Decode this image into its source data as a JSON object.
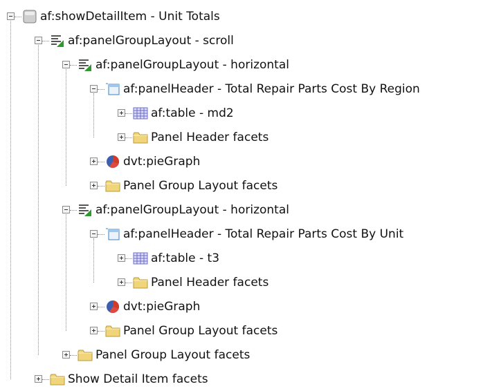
{
  "tree": {
    "nodes": [
      {
        "label": "af:showDetailItem - Unit Totals",
        "icon": "show-detail-item-icon",
        "expanded": true
      },
      {
        "label": "af:panelGroupLayout - scroll",
        "icon": "panel-group-layout-icon",
        "expanded": true
      },
      {
        "label": "af:panelGroupLayout - horizontal",
        "icon": "panel-group-layout-icon",
        "expanded": true
      },
      {
        "label": "af:panelHeader - Total Repair Parts Cost By Region",
        "icon": "panel-header-icon",
        "expanded": true
      },
      {
        "label": "af:table - md2",
        "icon": "table-icon",
        "expanded": false
      },
      {
        "label": "Panel Header facets",
        "icon": "folder-icon",
        "expanded": false
      },
      {
        "label": "dvt:pieGraph",
        "icon": "pie-graph-icon",
        "expanded": false
      },
      {
        "label": "Panel Group Layout facets",
        "icon": "folder-icon",
        "expanded": false
      },
      {
        "label": "af:panelGroupLayout - horizontal",
        "icon": "panel-group-layout-icon",
        "expanded": true
      },
      {
        "label": "af:panelHeader - Total Repair Parts Cost By Unit",
        "icon": "panel-header-icon",
        "expanded": true
      },
      {
        "label": "af:table - t3",
        "icon": "table-icon",
        "expanded": false
      },
      {
        "label": "Panel Header facets",
        "icon": "folder-icon",
        "expanded": false
      },
      {
        "label": "dvt:pieGraph",
        "icon": "pie-graph-icon",
        "expanded": false
      },
      {
        "label": "Panel Group Layout facets",
        "icon": "folder-icon",
        "expanded": false
      },
      {
        "label": "Panel Group Layout facets",
        "icon": "folder-icon",
        "expanded": false
      },
      {
        "label": "Show Detail Item facets",
        "icon": "folder-icon",
        "expanded": false
      }
    ]
  },
  "colors": {
    "folder": "#f1d57a",
    "grid": "#6b6bd0",
    "pie_blue": "#3d5fb0",
    "pie_red": "#d23a2a",
    "check_green": "#2e9a2e"
  }
}
